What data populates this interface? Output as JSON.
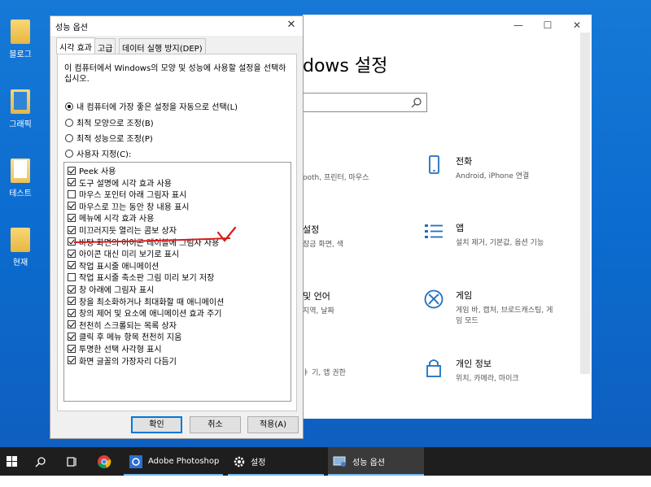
{
  "desktop": {
    "icons": [
      {
        "label": "블로그",
        "icon": "folder-icon"
      },
      {
        "label": "그래픽",
        "icon": "folder-document-icon"
      },
      {
        "label": "테스트",
        "icon": "folder-paper-icon"
      },
      {
        "label": "현재",
        "icon": "folder-icon"
      }
    ]
  },
  "settings_window": {
    "title": "dows 설정",
    "search_icon": "search-icon",
    "items": [
      {
        "title": "",
        "desc": "ooth, 프린터, 마우스",
        "icon": ""
      },
      {
        "title": "전화",
        "desc": "Android, iPhone 연결",
        "icon": "phone-icon"
      },
      {
        "title": "설정",
        "desc": "잠금 화면, 색",
        "icon": ""
      },
      {
        "title": "앱",
        "desc": "설치 제거, 기본값, 옵션 기능",
        "icon": "apps-icon"
      },
      {
        "title": "및 언어",
        "desc": "지역, 날짜",
        "icon": ""
      },
      {
        "title": "게임",
        "desc": "게임 바, 캡처, 브로드캐스팅, 게임 모드",
        "icon": "xbox-icon"
      },
      {
        "title": "",
        "desc": "ㅑ 기, 앱 권한",
        "icon": ""
      },
      {
        "title": "개인 정보",
        "desc": "위치, 카메라, 마이크",
        "icon": "lock-icon"
      }
    ]
  },
  "perf_dialog": {
    "title": "성능 옵션",
    "tabs": [
      "시각 효과",
      "고급",
      "데이터 실행 방지(DEP)"
    ],
    "selected_tab": 0,
    "description": "이 컴퓨터에서 Windows의 모양 및 성능에 사용할 설정을 선택하십시오.",
    "radios": [
      {
        "label": "내 컴퓨터에 가장 좋은 설정을 자동으로 선택(L)",
        "checked": true
      },
      {
        "label": "최적 모양으로 조정(B)",
        "checked": false
      },
      {
        "label": "최적 성능으로 조정(P)",
        "checked": false
      },
      {
        "label": "사용자 지정(C):",
        "checked": false
      }
    ],
    "options": [
      {
        "label": "Peek 사용",
        "checked": true
      },
      {
        "label": "도구 설명에 시각 효과 사용",
        "checked": true
      },
      {
        "label": "마우스 포인터 아래 그림자 표시",
        "checked": false
      },
      {
        "label": "마우스로 끄는 동안 창 내용 표시",
        "checked": true
      },
      {
        "label": "메뉴에 시각 효과 사용",
        "checked": true
      },
      {
        "label": "미끄러지듯 열리는 콤보 상자",
        "checked": true
      },
      {
        "label": "바탕 화면의 아이콘 레이블에 그림자 사용",
        "checked": true
      },
      {
        "label": "아이콘 대신 미리 보기로 표시",
        "checked": true
      },
      {
        "label": "작업 표시줄 애니메이션",
        "checked": true
      },
      {
        "label": "작업 표시줄 축소판 그림 미리 보기 저장",
        "checked": false
      },
      {
        "label": "창 아래에 그림자 표시",
        "checked": true
      },
      {
        "label": "창을 최소화하거나 최대화할 때 애니메이션",
        "checked": true
      },
      {
        "label": "창의 제어 및 요소에 애니메이션 효과 주기",
        "checked": true
      },
      {
        "label": "천천히 스크롤되는 목록 상자",
        "checked": true
      },
      {
        "label": "클릭 후 메뉴 항목 천천히 지움",
        "checked": true
      },
      {
        "label": "투명한 선택 사각형 표시",
        "checked": true
      },
      {
        "label": "화면 글꼴의 가장자리 다듬기",
        "checked": true
      }
    ],
    "buttons": {
      "ok": "확인",
      "cancel": "취소",
      "apply": "적용(A)"
    }
  },
  "taskbar": {
    "apps": [
      {
        "label": "Adobe Photoshop",
        "icon": "photoshop-icon"
      },
      {
        "label": "설정",
        "icon": "gear-icon"
      },
      {
        "label": "성능 옵션",
        "icon": "performance-options-icon"
      }
    ]
  },
  "colors": {
    "desktop": "#0c6cd0",
    "annotation": "#d81b1b",
    "accent": "#0078d7"
  }
}
